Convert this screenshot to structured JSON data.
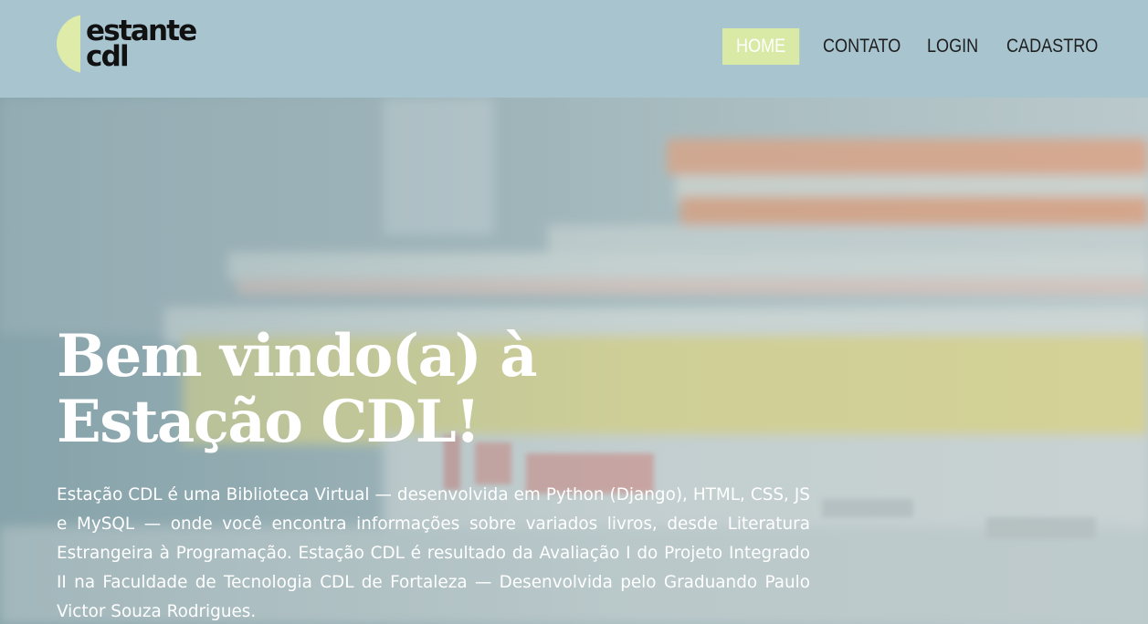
{
  "logo": {
    "line1": "estante",
    "line2": "cdl"
  },
  "nav": {
    "home": "HOME",
    "contato": "CONTATO",
    "login": "LOGIN",
    "cadastro": "CADASTRO"
  },
  "hero": {
    "title_line1": "Bem vindo(a) à",
    "title_line2": "Estação CDL!",
    "description": "Estação CDL é uma Biblioteca Virtual — desenvolvida em Python (Django), HTML, CSS, JS e MySQL — onde você encontra informações sobre variados livros, desde Literatura Estrangeira à Programação. Estação CDL é resultado da Avaliação I do Projeto Integrado II na Faculdade de Tecnologia CDL de Fortaleza — Desenvolvida pelo Graduando Paulo Victor Souza Rodrigues."
  },
  "colors": {
    "header_bg": "#a7c4cf",
    "nav_active_bg": "#d8eaa5",
    "logo_accent": "#dfeca9",
    "text_dark": "#1e1e1e",
    "hero_text": "#ffffff"
  }
}
